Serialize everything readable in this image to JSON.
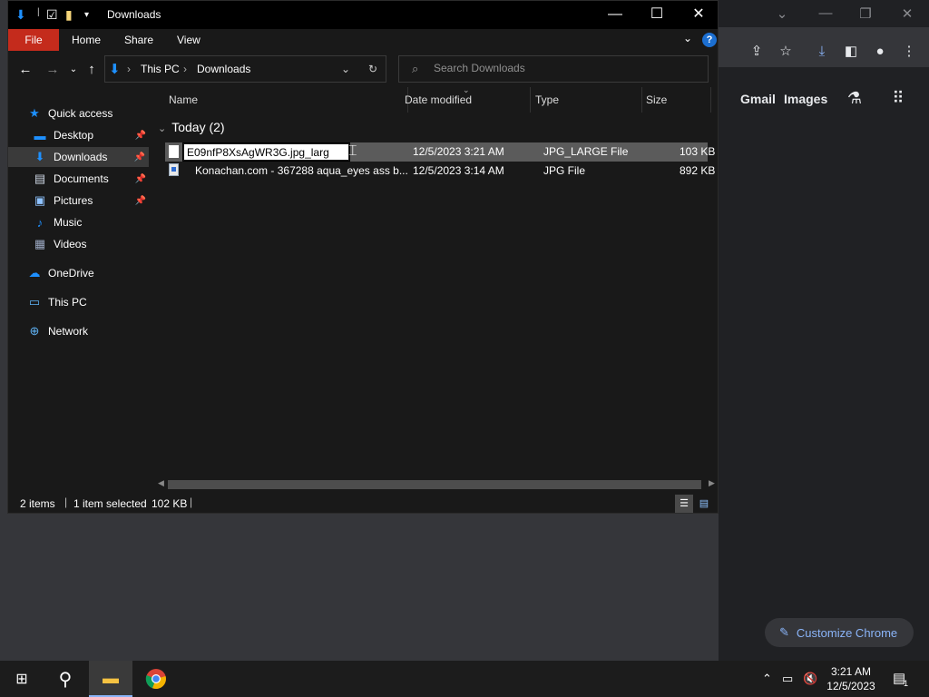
{
  "explorer": {
    "title": "Downloads",
    "ribbon_tabs": {
      "file": "File",
      "home": "Home",
      "share": "Share",
      "view": "View"
    },
    "help": "?",
    "address": {
      "this_pc": "This PC",
      "downloads": "Downloads"
    },
    "search": {
      "placeholder": "Search Downloads"
    },
    "nav": {
      "quick_access": "Quick access",
      "desktop": "Desktop",
      "downloads": "Downloads",
      "documents": "Documents",
      "pictures": "Pictures",
      "music": "Music",
      "videos": "Videos",
      "onedrive": "OneDrive",
      "this_pc": "This PC",
      "network": "Network"
    },
    "columns": {
      "name": "Name",
      "date": "Date modified",
      "type": "Type",
      "size": "Size"
    },
    "group": "Today (2)",
    "files": [
      {
        "name": "E09nfP8XsAgWR3G.jpg_larg",
        "date": "12/5/2023 3:21 AM",
        "type": "JPG_LARGE File",
        "size": "103 KB"
      },
      {
        "name": "Konachan.com - 367288 aqua_eyes ass b...",
        "date": "12/5/2023 3:14 AM",
        "type": "JPG File",
        "size": "892 KB"
      }
    ],
    "status": {
      "items": "2 items",
      "selected": "1 item selected",
      "size": "102 KB"
    }
  },
  "chrome": {
    "gmail": "Gmail",
    "images": "Images",
    "customize": "Customize Chrome"
  },
  "taskbar": {
    "time": "3:21 AM",
    "date": "12/5/2023",
    "notifications": "1"
  }
}
